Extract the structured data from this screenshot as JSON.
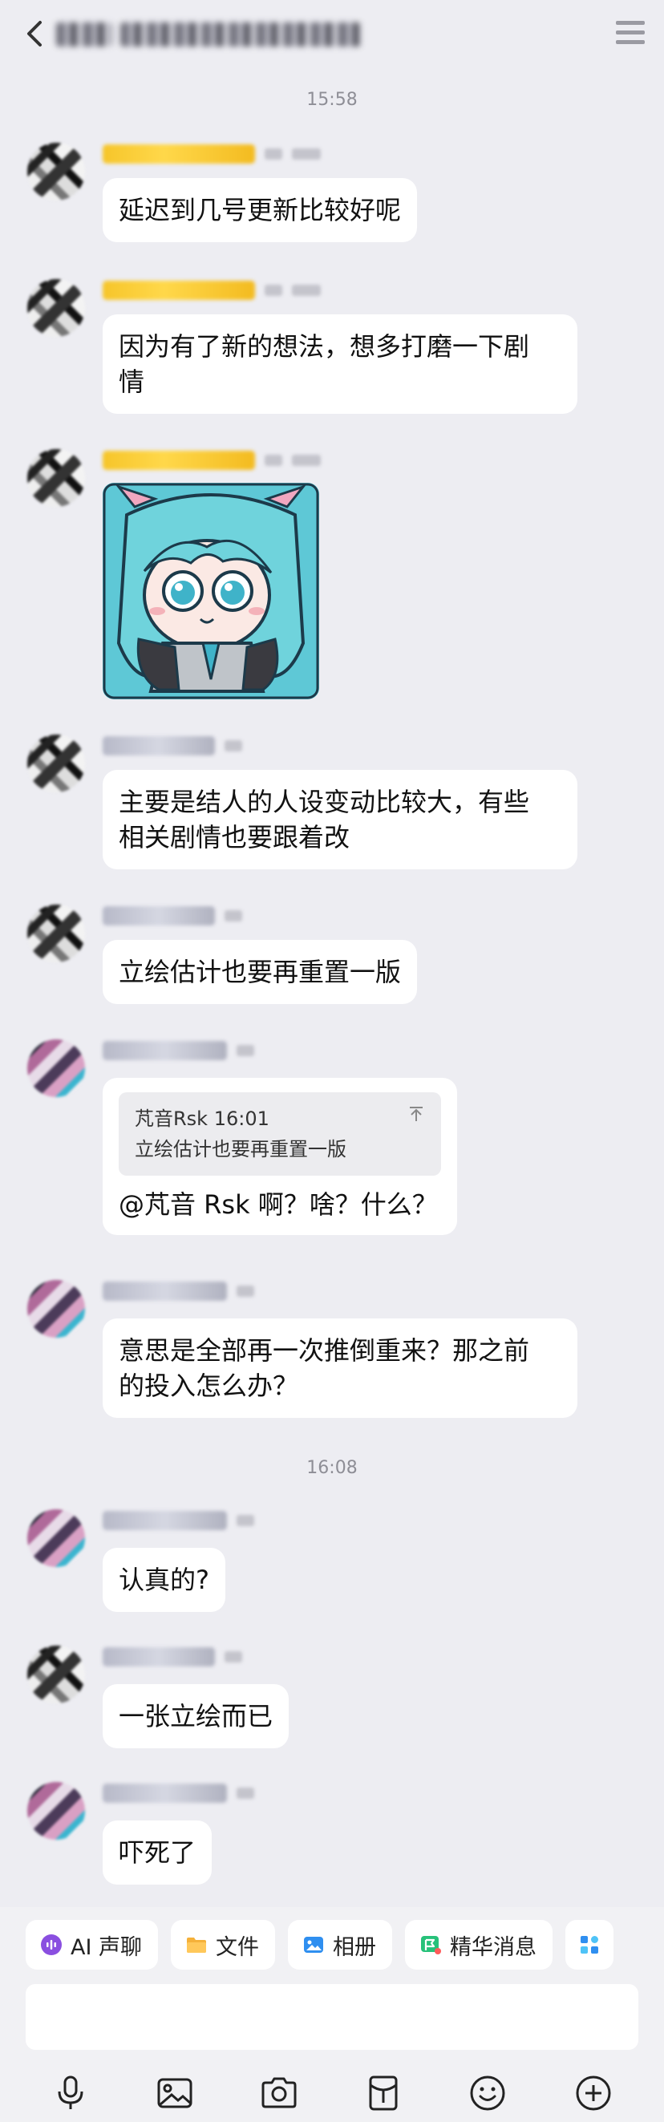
{
  "header": {
    "title": "",
    "back_icon": "chevron-left-icon",
    "menu_icon": "menu-icon"
  },
  "messages_section": {
    "time_1": "15:58",
    "time_2": "16:08"
  },
  "messages": [
    {
      "avatar": "avatar-a1",
      "text": "延迟到几号更新比较好呢"
    },
    {
      "avatar": "avatar-a1",
      "line1": "因为有了新的想法，想多打磨一下剧",
      "line2": "情"
    },
    {
      "avatar": "avatar-a1",
      "image": "anime-sticker"
    },
    {
      "avatar": "avatar-a1",
      "line1": "主要是结人的人设变动比较大，有些",
      "line2": "相关剧情也要跟着改"
    },
    {
      "avatar": "avatar-a1",
      "text": "立绘估计也要再重置一版"
    },
    {
      "avatar": "avatar-a2",
      "quote_header": "芃音Rsk 16:01",
      "quote_text": "立绘估计也要再重置一版",
      "text": "@芃音 Rsk 啊？啥？什么？"
    },
    {
      "avatar": "avatar-a2",
      "line1": "意思是全部再一次推倒重来？那之前",
      "line2": "的投入怎么办？"
    },
    {
      "avatar": "avatar-a2",
      "text": "认真的?"
    },
    {
      "avatar": "avatar-a1",
      "text": "一张立绘而已"
    },
    {
      "avatar": "avatar-a2",
      "text": "吓死了"
    }
  ],
  "quick_actions": [
    {
      "label": "AI 声聊",
      "icon": "ai-voice-icon",
      "color": "#8a4fe0"
    },
    {
      "label": "文件",
      "icon": "folder-icon",
      "color": "#f5b13a"
    },
    {
      "label": "相册",
      "icon": "album-icon",
      "color": "#2f8ff0"
    },
    {
      "label": "精华消息",
      "icon": "essence-flag-icon",
      "color": "#27c17a"
    },
    {
      "label": "",
      "icon": "apps-grid-icon",
      "color": "#2f8ff0"
    }
  ],
  "input": {
    "placeholder": ""
  },
  "toolbar": [
    {
      "icon": "microphone-icon"
    },
    {
      "icon": "image-icon"
    },
    {
      "icon": "camera-icon"
    },
    {
      "icon": "red-packet-icon"
    },
    {
      "icon": "emoji-icon"
    },
    {
      "icon": "plus-circle-icon"
    }
  ]
}
